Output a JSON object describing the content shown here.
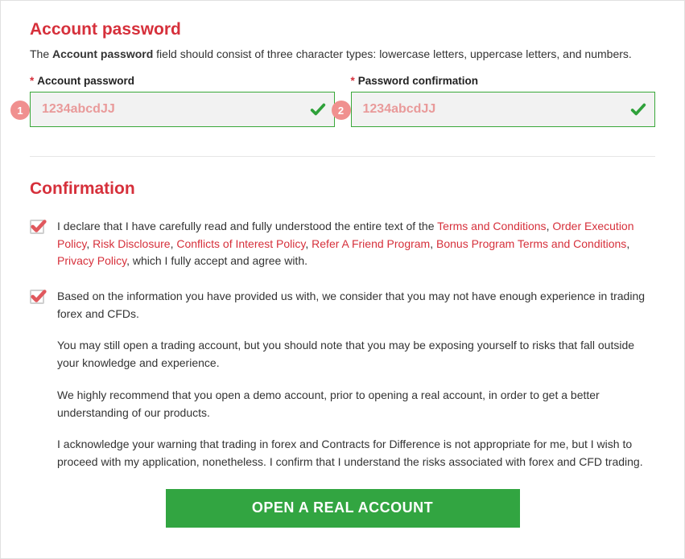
{
  "password_sect": {
    "title": "Account password",
    "desc_pre": "The ",
    "desc_strong": "Account password",
    "desc_post": " field should consist of three character types: lowercase letters, uppercase letters, and numbers.",
    "field1_label": "Account password",
    "field1_value": "1234abcdJJ",
    "field1_badge": "1",
    "field2_label": "Password confirmation",
    "field2_value": "1234abcdJJ",
    "field2_badge": "2"
  },
  "confirm_sect": {
    "title": "Confirmation",
    "cb1": {
      "pre": "I declare that I have carefully read and fully understood the entire text of the ",
      "links": [
        "Terms and Conditions",
        "Order Execution Policy",
        "Risk Disclosure",
        "Conflicts of Interest Policy",
        "Refer A Friend Program",
        "Bonus Program Terms and Conditions",
        "Privacy Policy"
      ],
      "post": ", which I fully accept and agree with."
    },
    "cb2": {
      "p1": "Based on the information you have provided us with, we consider that you may not have enough experience in trading forex and CFDs.",
      "p2": "You may still open a trading account, but you should note that you may be exposing yourself to risks that fall outside your knowledge and experience.",
      "p3": "We highly recommend that you open a demo account, prior to opening a real account, in order to get a better understanding of our products.",
      "p4": "I acknowledge your warning that trading in forex and Contracts for Difference is not appropriate for me, but I wish to proceed with my application, nonetheless. I confirm that I understand the risks associated with forex and CFD trading."
    }
  },
  "cta_label": "OPEN A REAL ACCOUNT"
}
